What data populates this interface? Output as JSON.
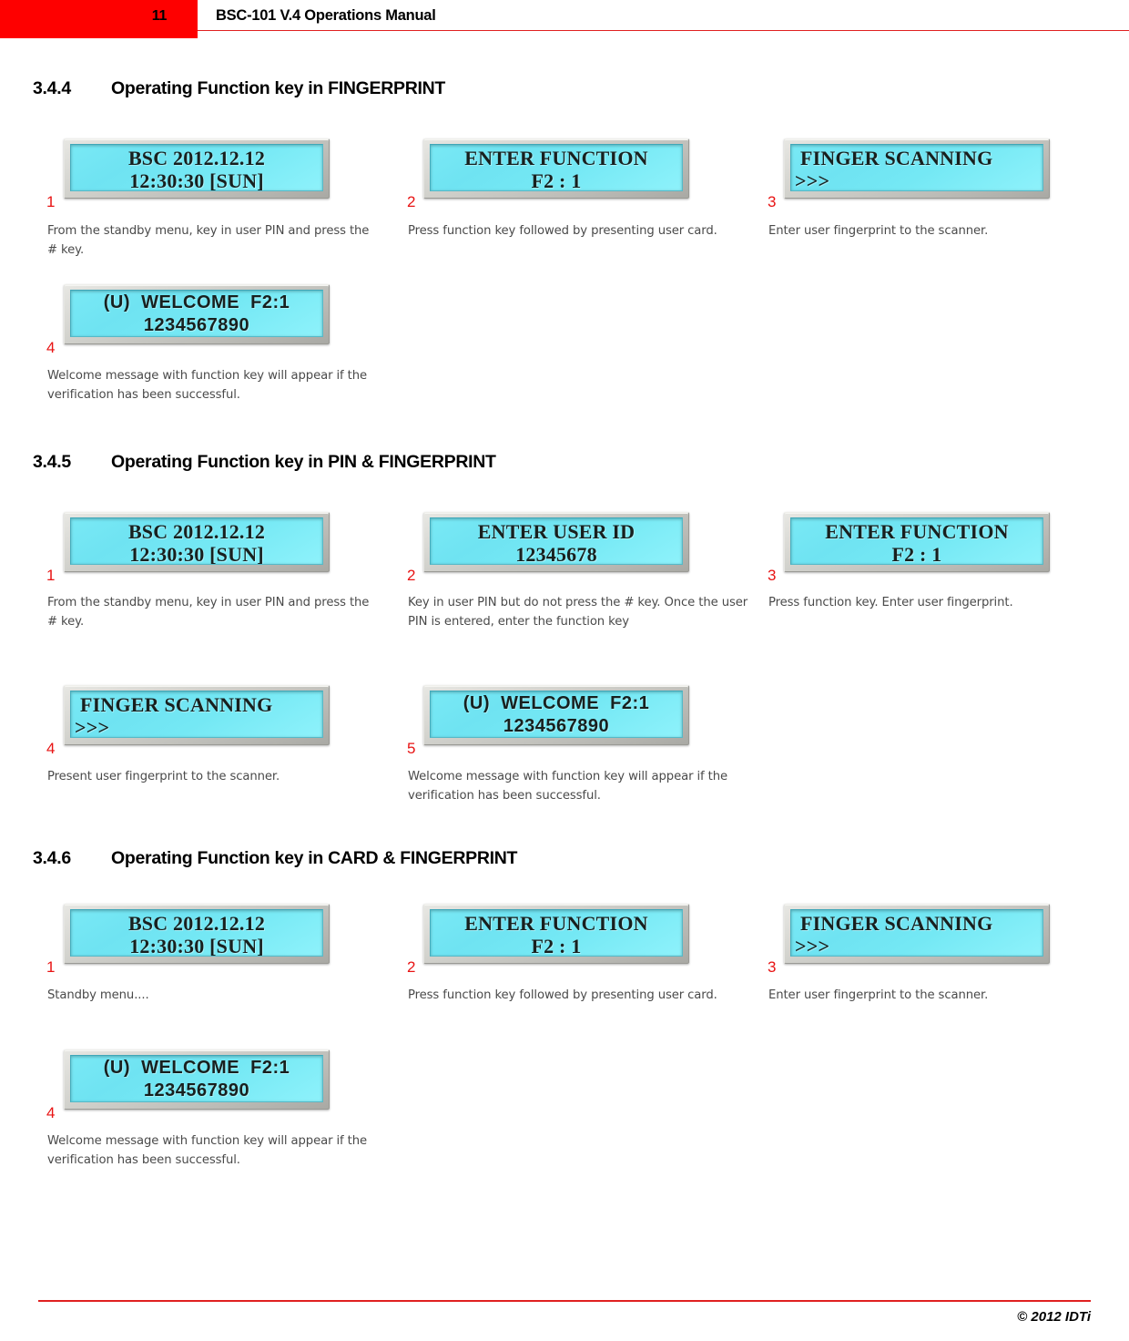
{
  "header": {
    "page_number": "11",
    "title": "BSC-101 V.4 Operations Manual",
    "accent_color": "#fe0000"
  },
  "footer": {
    "copyright": "© 2012 IDTi",
    "rule_color": "#e02020"
  },
  "sections": [
    {
      "number": "3.4.4",
      "title": "Operating Function key in FINGERPRINT",
      "steps": [
        {
          "index": "1",
          "lcd_line1": "BSC 2012.12.12",
          "lcd_line2": "12:30:30 [SUN]",
          "caption": "From the standby menu, key in user PIN and press the # key."
        },
        {
          "index": "2",
          "lcd_line1": "ENTER FUNCTION",
          "lcd_line2": "F2 : 1",
          "caption": "Press function key followed by presenting user card."
        },
        {
          "index": "3",
          "lcd_line1": "FINGER SCANNING",
          "lcd_line2": ">>>",
          "caption": "Enter user fingerprint to the scanner."
        },
        {
          "index": "4",
          "lcd_line1": "(U)  WELCOME  F2:1",
          "lcd_line2": "1234567890",
          "caption": "Welcome message with function key will appear if the verification has been successful."
        }
      ]
    },
    {
      "number": "3.4.5",
      "title": "Operating Function key in PIN & FINGERPRINT",
      "steps": [
        {
          "index": "1",
          "lcd_line1": "BSC 2012.12.12",
          "lcd_line2": "12:30:30 [SUN]",
          "caption": "From the standby menu, key in user PIN and press the # key."
        },
        {
          "index": "2",
          "lcd_line1": "ENTER USER ID",
          "lcd_line2": "12345678",
          "caption": "Key in user PIN but do not press the # key. Once the user PIN is entered, enter the function key"
        },
        {
          "index": "3",
          "lcd_line1": "ENTER FUNCTION",
          "lcd_line2": "F2 : 1",
          "caption": "Press function key. Enter user fingerprint."
        },
        {
          "index": "4",
          "lcd_line1": "FINGER SCANNING",
          "lcd_line2": ">>>",
          "caption": "Present user fingerprint to the scanner."
        },
        {
          "index": "5",
          "lcd_line1": "(U)  WELCOME  F2:1",
          "lcd_line2": "1234567890",
          "caption": "Welcome message with function key will appear if the verification has been successful."
        }
      ]
    },
    {
      "number": "3.4.6",
      "title": "Operating Function key in CARD & FINGERPRINT",
      "steps": [
        {
          "index": "1",
          "lcd_line1": "BSC 2012.12.12",
          "lcd_line2": "12:30:30 [SUN]",
          "caption": "Standby menu...."
        },
        {
          "index": "2",
          "lcd_line1": "ENTER FUNCTION",
          "lcd_line2": "F2 : 1",
          "caption": "Press function key followed by presenting user card."
        },
        {
          "index": "3",
          "lcd_line1": "FINGER SCANNING",
          "lcd_line2": ">>>",
          "caption": "Enter user fingerprint to the scanner."
        },
        {
          "index": "4",
          "lcd_line1": "(U)  WELCOME  F2:1",
          "lcd_line2": "1234567890",
          "caption": "Welcome message with function key will appear if the verification has been successful."
        }
      ]
    }
  ]
}
